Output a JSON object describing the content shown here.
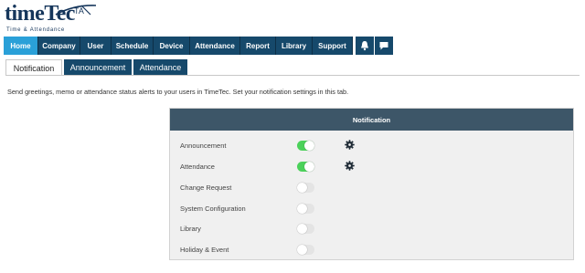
{
  "logo": {
    "word_time": "time",
    "word_tec": "Tec",
    "ta": "TA",
    "tagline": "Time & Attendance"
  },
  "nav": {
    "items": [
      {
        "label": "Home",
        "active": true
      },
      {
        "label": "Company",
        "active": false
      },
      {
        "label": "User",
        "active": false
      },
      {
        "label": "Schedule",
        "active": false
      },
      {
        "label": "Device",
        "active": false
      },
      {
        "label": "Attendance",
        "active": false
      },
      {
        "label": "Report",
        "active": false
      },
      {
        "label": "Library",
        "active": false
      },
      {
        "label": "Support",
        "active": false
      }
    ],
    "icons": [
      "bell-icon",
      "chat-bubble-icon"
    ]
  },
  "tabs": [
    {
      "label": "Notification",
      "active": true
    },
    {
      "label": "Announcement",
      "active": false
    },
    {
      "label": "Attendance",
      "active": false
    }
  ],
  "description": "Send greetings, memo or attendance status alerts to your users in TimeTec. Set your notification settings in this tab.",
  "panel": {
    "title": "Notification",
    "rows": [
      {
        "label": "Announcement",
        "enabled": true,
        "settings_icon": "gear-icon"
      },
      {
        "label": "Attendance",
        "enabled": true,
        "settings_icon": "gear-icon"
      },
      {
        "label": "Change Request",
        "enabled": false
      },
      {
        "label": "System Configuration",
        "enabled": false
      },
      {
        "label": "Library",
        "enabled": false
      },
      {
        "label": "Holiday & Event",
        "enabled": false
      }
    ]
  },
  "colors": {
    "nav_bg": "#16496b",
    "nav_active": "#2aa0d8",
    "panel_header": "#3d5668",
    "toggle_on": "#4bd15a",
    "toggle_off": "#e4e4e4",
    "brand": "#16365b"
  }
}
